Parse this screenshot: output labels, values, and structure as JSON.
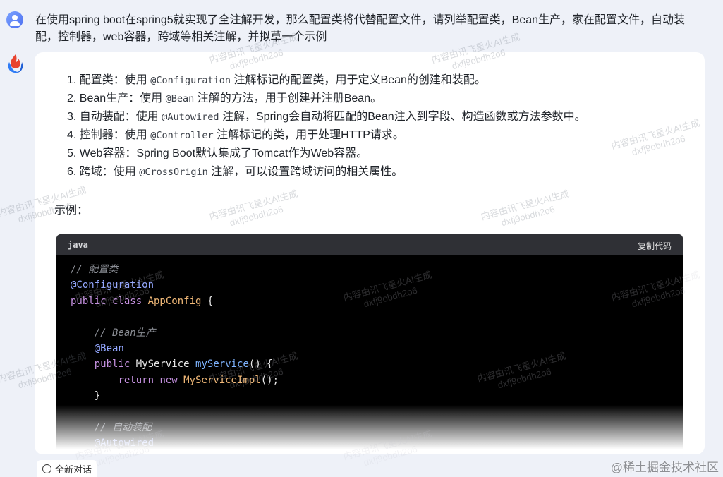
{
  "question": "在使用spring boot在spring5就实现了全注解开发，那么配置类将代替配置文件，请列举配置类，Bean生产，家在配置文件，自动装配，控制器，web容器，跨域等相关注解，并拟草一个示例",
  "answer": {
    "points": [
      {
        "num": "1.",
        "pre": "配置类：使用",
        "code": "@Configuration",
        "post": "注解标记的配置类，用于定义Bean的创建和装配。"
      },
      {
        "num": "2.",
        "pre": "Bean生产：使用",
        "code": "@Bean",
        "post": "注解的方法，用于创建并注册Bean。"
      },
      {
        "num": "3.",
        "pre": "自动装配：使用",
        "code": "@Autowired",
        "post": "注解，Spring会自动将匹配的Bean注入到字段、构造函数或方法参数中。"
      },
      {
        "num": "4.",
        "pre": "控制器：使用",
        "code": "@Controller",
        "post": "注解标记的类，用于处理HTTP请求。"
      },
      {
        "num": "5.",
        "pre": "Web容器：Spring Boot默认集成了Tomcat作为Web容器。",
        "code": "",
        "post": ""
      },
      {
        "num": "6.",
        "pre": "跨域：使用",
        "code": "@CrossOrigin",
        "post": "注解，可以设置跨域访问的相关属性。"
      }
    ],
    "example_label": "示例：",
    "code_block": {
      "language": "java",
      "copy_label": "复制代码",
      "lines": [
        {
          "c": "// 配置类"
        },
        {
          "a": "@Configuration"
        },
        {
          "k": "public class ",
          "t": "AppConfig",
          "p": " {"
        },
        {
          "p": ""
        },
        {
          "i": "    ",
          "c": "// Bean生产"
        },
        {
          "i": "    ",
          "a": "@Bean"
        },
        {
          "i": "    ",
          "k": "public ",
          "p0": "MyService ",
          "f": "myService",
          "p": "() {"
        },
        {
          "i": "        ",
          "k": "return new ",
          "t": "MyServiceImpl",
          "p": "();"
        },
        {
          "i": "    ",
          "p": "}"
        },
        {
          "p": ""
        },
        {
          "i": "    ",
          "c": "// 自动装配"
        },
        {
          "i": "    ",
          "a": "@Autowired"
        }
      ]
    }
  },
  "footer": {
    "new_chat_label": "全新对话",
    "credit": "@稀土掘金技术社区"
  },
  "watermark": {
    "line1": "内容由讯飞星火AI生成",
    "line2": "dxfj9obdh2o6"
  }
}
